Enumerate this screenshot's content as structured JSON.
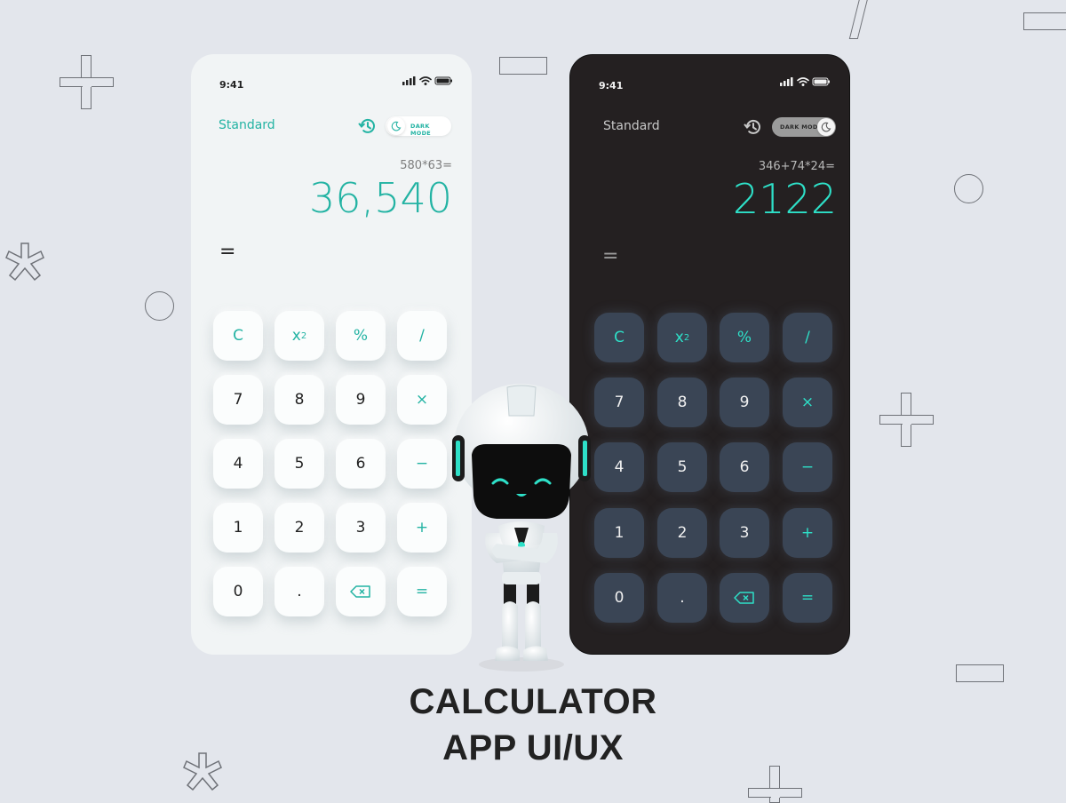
{
  "light_phone": {
    "time": "9:41",
    "mode_label": "Standard",
    "toggle_label": "DARK MODE",
    "expression": "580*63=",
    "result": "36,540",
    "equals_symbol": "="
  },
  "dark_phone": {
    "time": "9:41",
    "mode_label": "Standard",
    "toggle_label": "DARK MODE",
    "expression": "346+74*24=",
    "result": "2122",
    "equals_symbol": "="
  },
  "keys": {
    "clear": "C",
    "square_base": "x",
    "square_exp": "2",
    "percent": "%",
    "divide": "/",
    "seven": "7",
    "eight": "8",
    "nine": "9",
    "multiply": "×",
    "four": "4",
    "five": "5",
    "six": "6",
    "minus": "−",
    "one": "1",
    "two": "2",
    "three": "3",
    "plus": "+",
    "zero": "0",
    "dot": ".",
    "equals": "="
  },
  "headline": {
    "line1": "CALCULATOR",
    "line2": "APP UI/UX"
  },
  "colors": {
    "accent_light": "#23b3a3",
    "accent_dark": "#2ee0c8",
    "dark_key_bg": "#3a4555",
    "dark_phone_bg": "#242021",
    "light_phone_bg": "#f1f4f5",
    "page_bg": "#e3e6ec"
  },
  "icons": [
    "signal-icon",
    "wifi-icon",
    "battery-icon",
    "history-icon",
    "moon-icon",
    "backspace-icon",
    "robot-mascot"
  ]
}
